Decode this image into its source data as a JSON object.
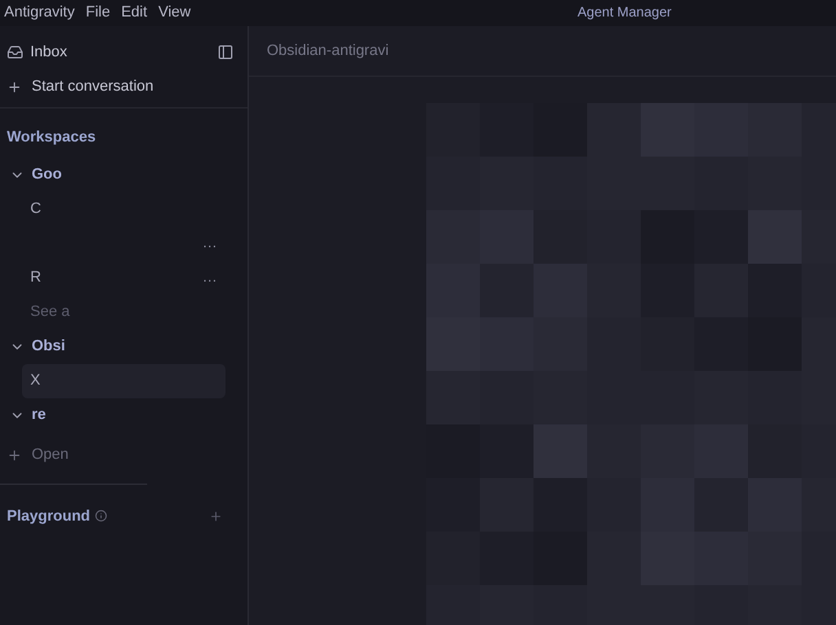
{
  "menu": [
    "Antigravity",
    "File",
    "Edit",
    "View"
  ],
  "window": {
    "title": "Agent Manager"
  },
  "sidebar": {
    "inbox": "Inbox",
    "start": "Start conversation",
    "workspaces_heading": "Workspaces",
    "workspaces": [
      {
        "name": "Goo",
        "expanded": true,
        "items": [
          {
            "label": "C",
            "selected": false
          },
          {
            "trailing": "…",
            "selected": false
          },
          {
            "label": "R",
            "trailing": "…",
            "selected": false
          },
          {
            "label": "See a",
            "kind": "more",
            "selected": false
          }
        ]
      },
      {
        "name": "Obsi",
        "expanded": true,
        "items": [
          {
            "label": "X",
            "selected": true
          }
        ]
      },
      {
        "name": "re",
        "expanded": true
      }
    ],
    "open": "Open",
    "playground": "Playground"
  },
  "tab": {
    "label": "Obsidian-antigravi"
  }
}
